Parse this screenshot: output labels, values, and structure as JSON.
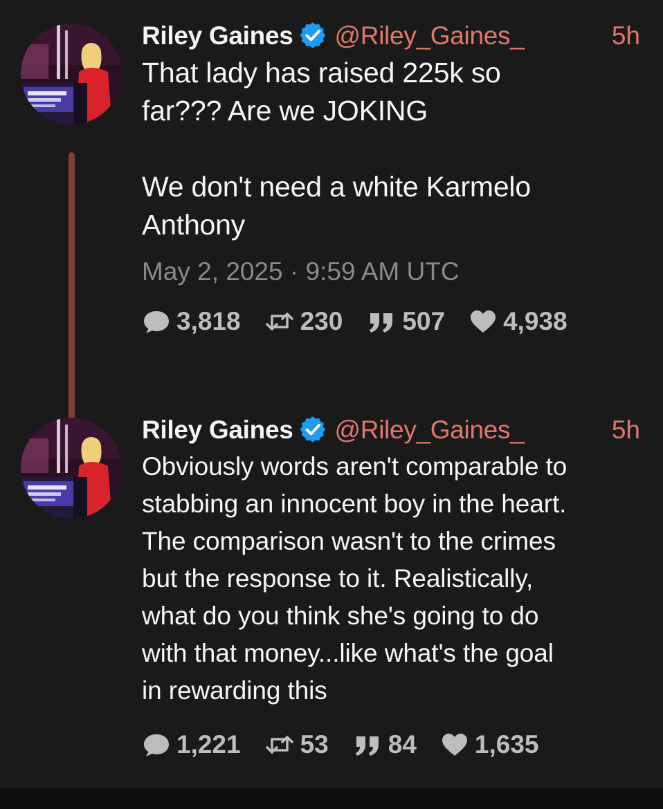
{
  "tweets": [
    {
      "author_name": "Riley Gaines",
      "handle": "@Riley_Gaines_",
      "time": "5h",
      "text": "That lady has raised 225k so\nfar??? Are we JOKING\n\nWe don't need a white Karmelo\nAnthony",
      "date": "May 2, 2025 · 9:59 AM UTC",
      "stats": {
        "replies": "3,818",
        "retweets": "230",
        "quotes": "507",
        "likes": "4,938"
      }
    },
    {
      "author_name": "Riley Gaines",
      "handle": "@Riley_Gaines_",
      "time": "5h",
      "text": "Obviously words aren't comparable to\nstabbing an innocent boy in the heart.\nThe comparison wasn't to the crimes\nbut the response to it. Realistically,\nwhat do you think she's going to do\nwith that money...like what's the goal\nin rewarding this",
      "stats": {
        "replies": "1,221",
        "retweets": "53",
        "quotes": "84",
        "likes": "1,635"
      }
    }
  ],
  "colors": {
    "background": "#1a1a1a",
    "handle": "#e0786a",
    "verified": "#1d9bf0",
    "thread_line": "#7e3f38",
    "muted": "#8a8a8a",
    "stats": "#bdbdbd"
  },
  "icons": {
    "verified": "verified-badge-icon",
    "reply": "comment-bubble-icon",
    "retweet": "retweet-icon",
    "quote": "quote-icon",
    "like": "heart-icon"
  }
}
